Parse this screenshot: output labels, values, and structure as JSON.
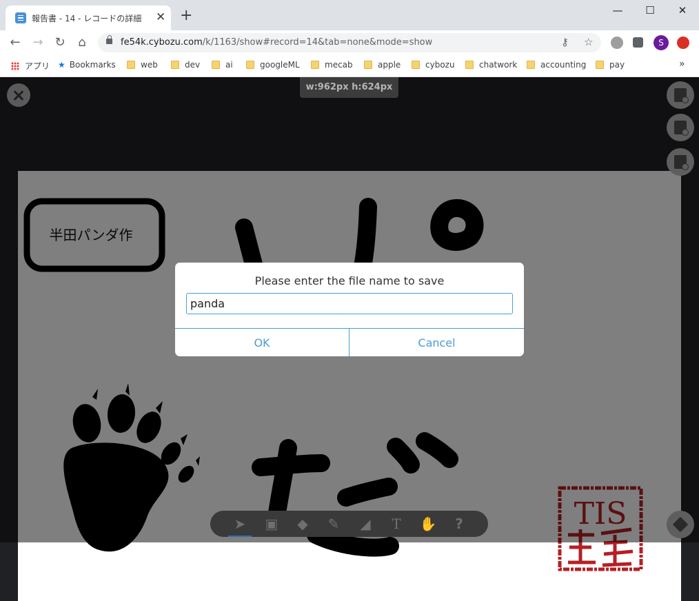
{
  "browser": {
    "tab_title": "報告書 - 14 - レコードの詳細",
    "tab_close": "✕",
    "new_tab": "+",
    "url_host": "fe54k.cybozu.com",
    "url_path": "/k/1163/show#record=14&tab=none&mode=show",
    "avatar_letter": "S",
    "window_controls": [
      "—",
      "☐",
      "✕"
    ]
  },
  "bookmarks": [
    {
      "label": "アプリ",
      "kind": "apps"
    },
    {
      "label": "Bookmarks",
      "kind": "star"
    },
    {
      "label": "web",
      "kind": "folder"
    },
    {
      "label": "dev",
      "kind": "folder"
    },
    {
      "label": "ai",
      "kind": "folder"
    },
    {
      "label": "googleML",
      "kind": "folder"
    },
    {
      "label": "mecab",
      "kind": "folder"
    },
    {
      "label": "apple",
      "kind": "folder"
    },
    {
      "label": "cybozu",
      "kind": "folder"
    },
    {
      "label": "chatwork",
      "kind": "folder"
    },
    {
      "label": "accounting",
      "kind": "folder"
    },
    {
      "label": "pay",
      "kind": "folder"
    }
  ],
  "bookmarks_more": "»",
  "canvas": {
    "size_label": "w:962px  h:624px",
    "author_label": "半田パンダ作",
    "stamp_text": "TIS"
  },
  "dialog": {
    "title": "Please enter the file name to save",
    "filename_value": "panda",
    "ok_label": "OK",
    "cancel_label": "Cancel"
  },
  "bottom_tools": [
    {
      "name": "select-tool",
      "glyph": "➤"
    },
    {
      "name": "image-tool",
      "glyph": "▣"
    },
    {
      "name": "shapes-tool",
      "glyph": "◆"
    },
    {
      "name": "pen-tool",
      "glyph": "✎"
    },
    {
      "name": "eraser-tool",
      "glyph": "◢"
    },
    {
      "name": "text-tool",
      "glyph": "T"
    },
    {
      "name": "hand-tool",
      "glyph": "✋"
    },
    {
      "name": "help-tool",
      "glyph": "?"
    }
  ],
  "colors": {
    "accent": "#4a9cd6",
    "stamp_red": "#b52025",
    "canvas_bg": "#ffffff"
  }
}
